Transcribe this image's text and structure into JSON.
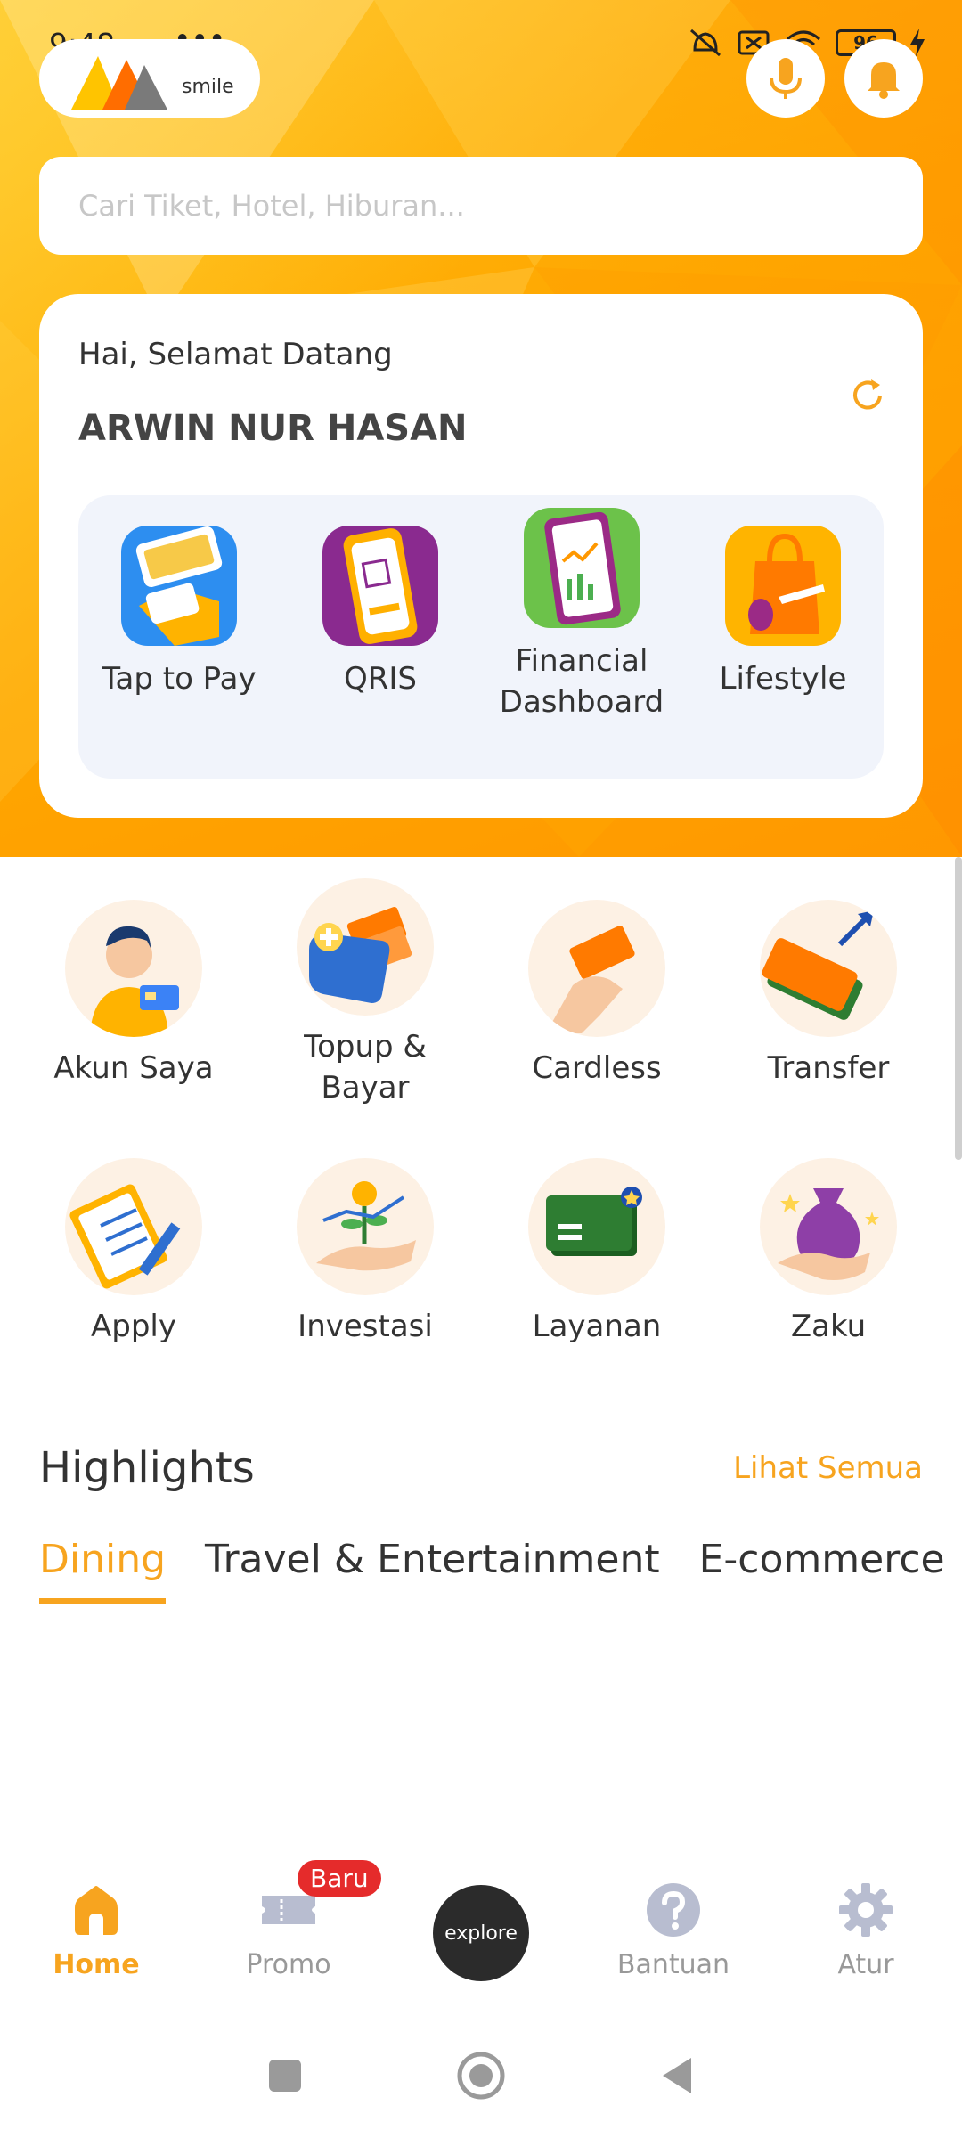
{
  "status_bar": {
    "time": "9:48",
    "dots": "•••",
    "battery": "96"
  },
  "brand": {
    "text": "smile",
    "color": "#f7a41f"
  },
  "header": {
    "mic_icon": "microphone-icon",
    "bell_icon": "bell-icon"
  },
  "search": {
    "placeholder": "Cari Tiket, Hotel, Hiburan..."
  },
  "welcome": {
    "greeting": "Hai, Selamat Datang",
    "name": "ARWIN NUR HASAN",
    "quick_actions": [
      {
        "label": "Tap to Pay",
        "icon": "tap-to-pay-icon"
      },
      {
        "label": "QRIS",
        "icon": "qris-icon"
      },
      {
        "label": "Financial Dashboard",
        "icon": "financial-dashboard-icon"
      },
      {
        "label": "Lifestyle",
        "icon": "lifestyle-icon"
      }
    ]
  },
  "menu": [
    {
      "label": "Akun Saya",
      "icon": "account-icon"
    },
    {
      "label": "Topup & Bayar",
      "icon": "wallet-icon"
    },
    {
      "label": "Cardless",
      "icon": "cash-hand-icon"
    },
    {
      "label": "Transfer",
      "icon": "transfer-icon"
    },
    {
      "label": "Apply",
      "icon": "clipboard-icon"
    },
    {
      "label": "Investasi",
      "icon": "investment-icon"
    },
    {
      "label": "Layanan",
      "icon": "card-service-icon"
    },
    {
      "label": "Zaku",
      "icon": "money-bag-icon"
    }
  ],
  "highlights": {
    "title": "Highlights",
    "see_all": "Lihat Semua",
    "tabs": [
      "Dining",
      "Travel & Entertainment",
      "E-commerce"
    ],
    "active_tab": "Dining"
  },
  "bottom_nav": {
    "items": [
      {
        "label": "Home",
        "icon": "home-icon",
        "active": true
      },
      {
        "label": "Promo",
        "icon": "ticket-icon",
        "badge": "Baru"
      },
      {
        "label": "explore",
        "icon": "explore-button"
      },
      {
        "label": "Bantuan",
        "icon": "help-icon"
      },
      {
        "label": "Atur",
        "icon": "gear-icon"
      }
    ]
  },
  "colors": {
    "accent": "#f7a41f",
    "header_bg": "#ffab00",
    "dark": "#2b2b2b",
    "badge": "#e52b2b"
  }
}
